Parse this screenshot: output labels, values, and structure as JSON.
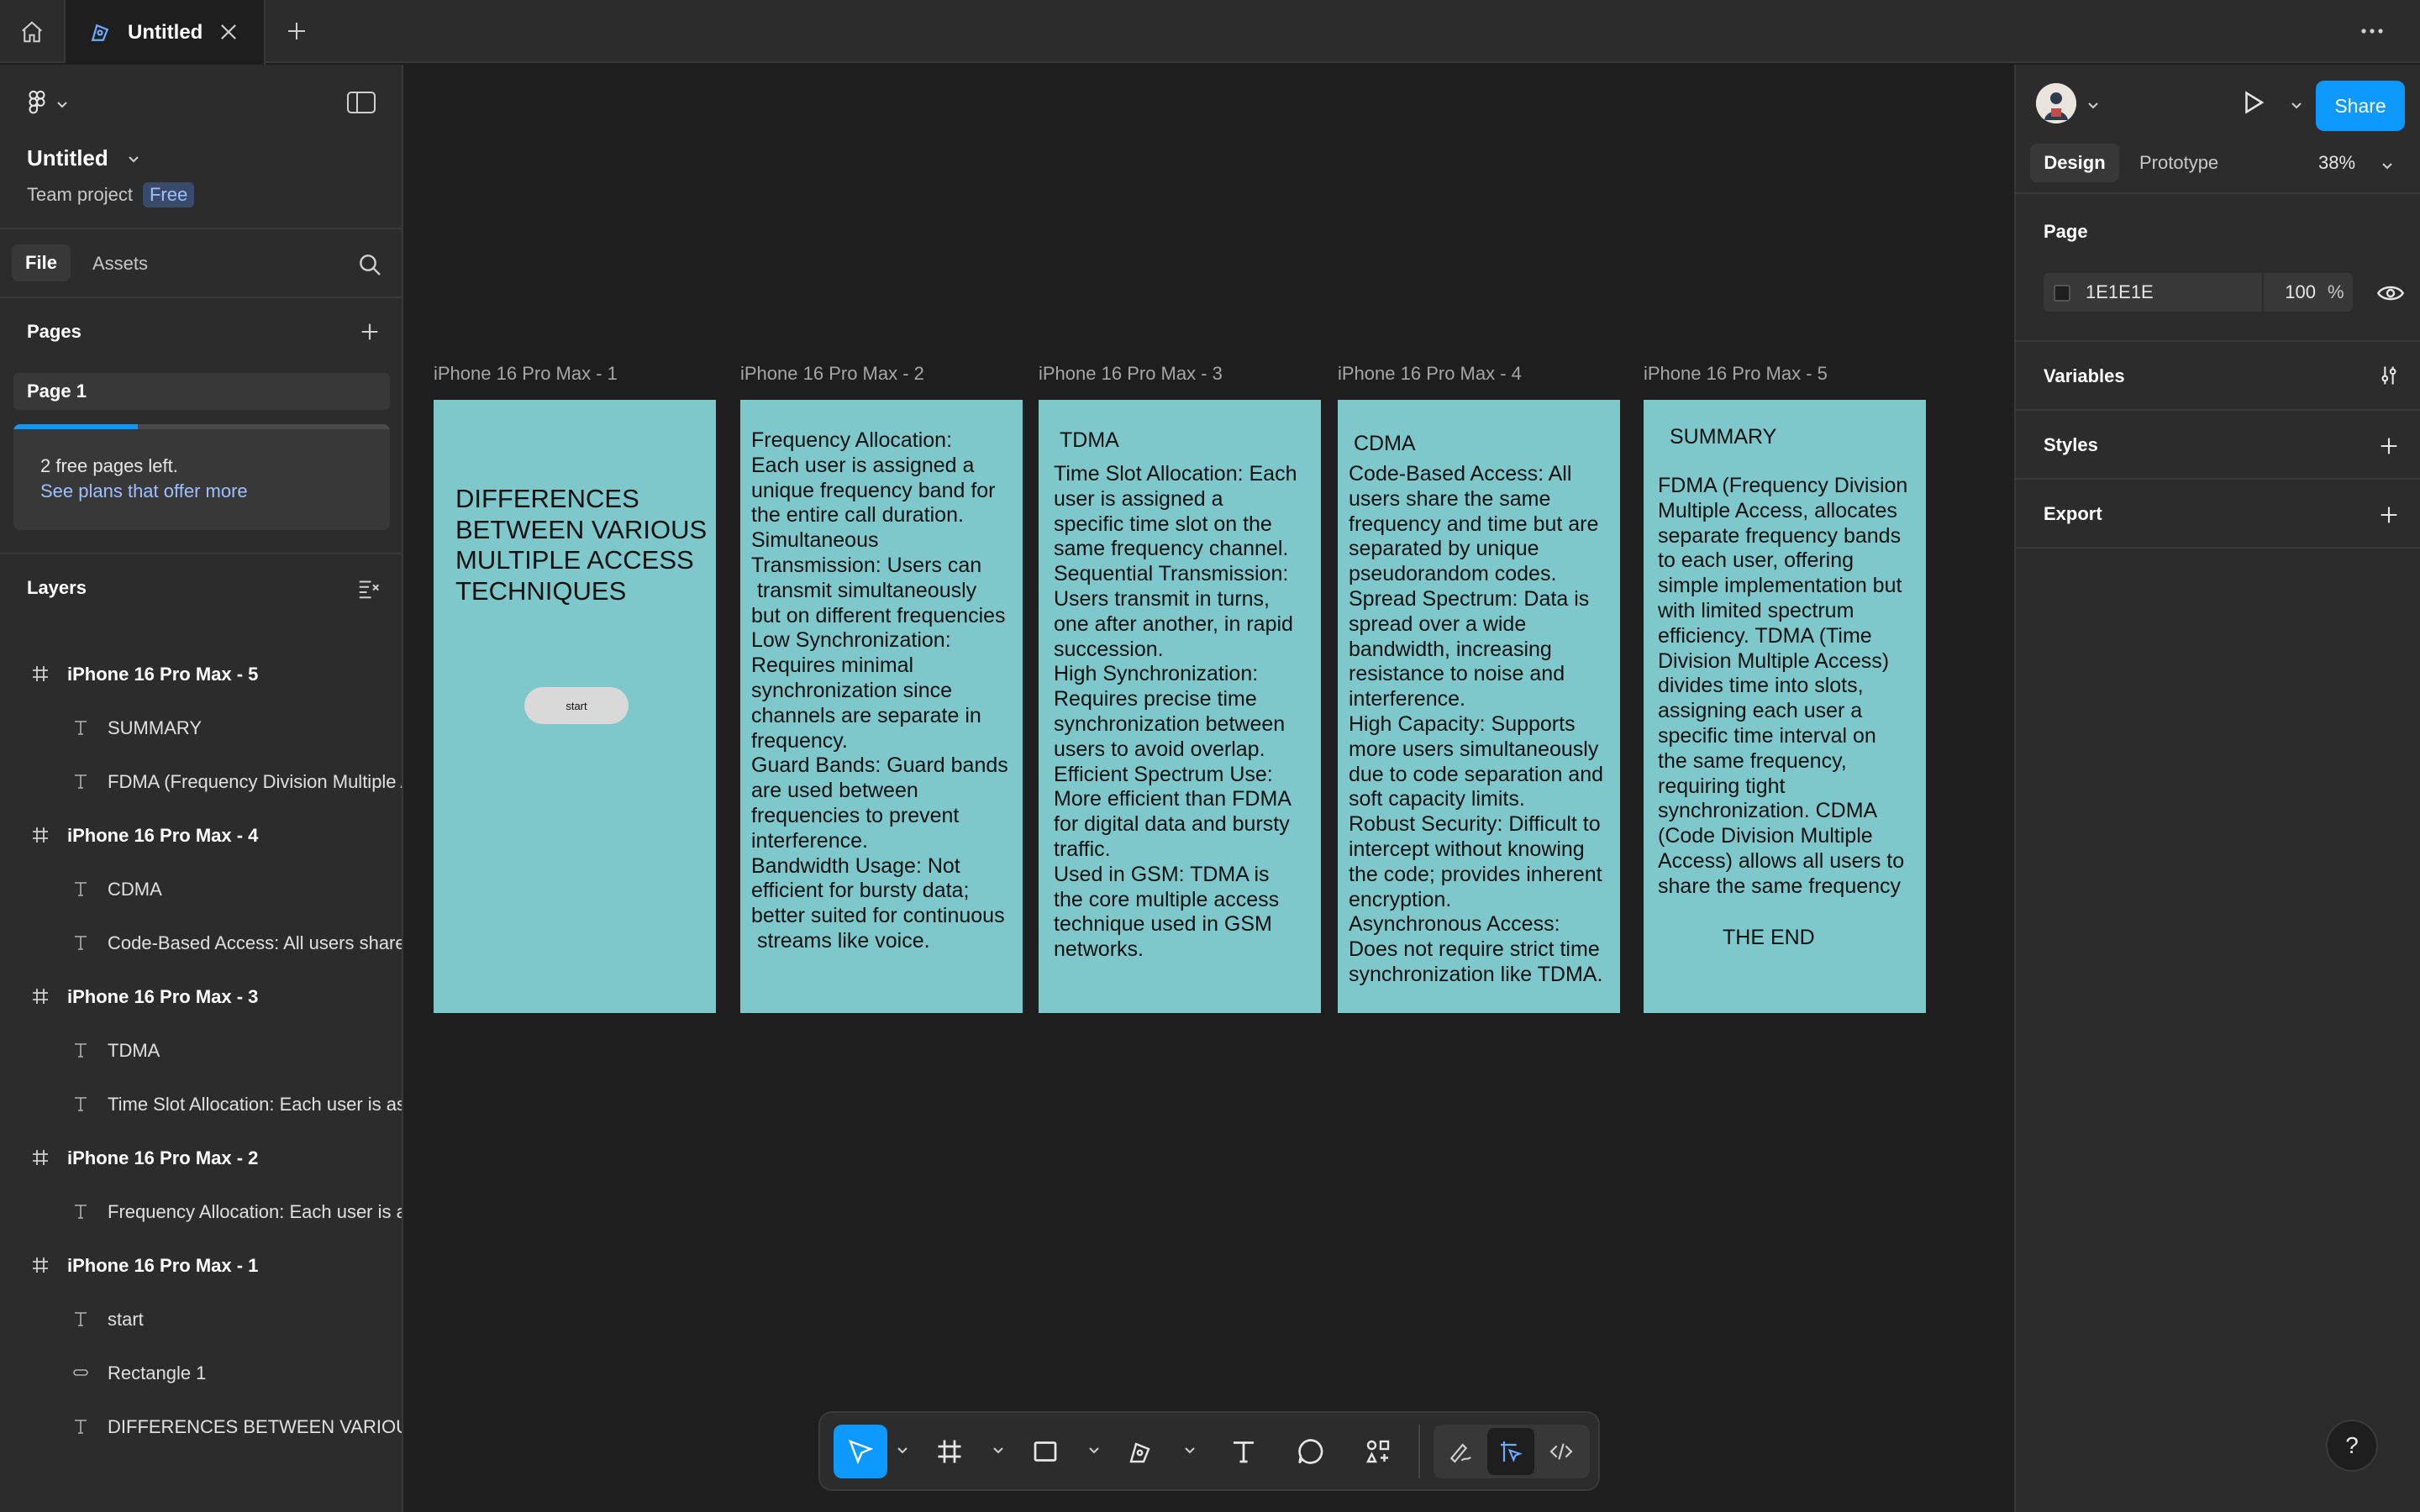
{
  "tabs": {
    "active_title": "Untitled"
  },
  "left_panel": {
    "file_name": "Untitled",
    "team_label": "Team project",
    "plan_badge": "Free",
    "tab_file": "File",
    "tab_assets": "Assets",
    "pages_header": "Pages",
    "pages": [
      {
        "label": "Page 1"
      }
    ],
    "pages_used_fraction": 0.33,
    "notice_text": "2 free pages left.",
    "notice_link": "See plans that offer more",
    "layers_header": "Layers",
    "layers": [
      {
        "label": "iPhone 16 Pro Max - 5",
        "kind": "frame"
      },
      {
        "label": "SUMMARY",
        "kind": "text"
      },
      {
        "label": "FDMA (Frequency Division Multiple Access, allocates",
        "kind": "text"
      },
      {
        "label": "iPhone 16 Pro Max - 4",
        "kind": "frame"
      },
      {
        "label": "CDMA",
        "kind": "text"
      },
      {
        "label": "Code-Based Access: All users share the same frequency",
        "kind": "text"
      },
      {
        "label": "iPhone 16 Pro Max - 3",
        "kind": "frame"
      },
      {
        "label": "TDMA",
        "kind": "text"
      },
      {
        "label": "Time Slot Allocation: Each user is assigned a specific",
        "kind": "text"
      },
      {
        "label": "iPhone 16 Pro Max - 2",
        "kind": "frame"
      },
      {
        "label": "Frequency Allocation: Each user is assigned a unique",
        "kind": "text"
      },
      {
        "label": "iPhone 16 Pro Max - 1",
        "kind": "frame"
      },
      {
        "label": "start",
        "kind": "text"
      },
      {
        "label": "Rectangle 1",
        "kind": "rectangle"
      },
      {
        "label": "DIFFERENCES BETWEEN VARIOUS MULTIPLE ACCESS TECHNIQUES",
        "kind": "text"
      }
    ]
  },
  "canvas": {
    "frames": [
      {
        "name": "iPhone 16 Pro Max - 1"
      },
      {
        "name": "iPhone 16 Pro Max - 2"
      },
      {
        "name": "iPhone 16 Pro Max - 3"
      },
      {
        "name": "iPhone 16 Pro Max - 4"
      },
      {
        "name": "iPhone 16 Pro Max - 5"
      }
    ],
    "frame1": {
      "title": "DIFFERENCES\nBETWEEN VARIOUS\nMULTIPLE ACCESS\nTECHNIQUES",
      "button_label": "start"
    },
    "frame2": {
      "body": "Frequency Allocation:\nEach user is assigned a\nunique frequency band for\nthe entire call duration.\nSimultaneous\nTransmission: Users can\n transmit simultaneously\nbut on different frequencies\nLow Synchronization:\nRequires minimal\nsynchronization since\nchannels are separate in\nfrequency.\nGuard Bands: Guard bands\nare used between\nfrequencies to prevent\ninterference.\nBandwidth Usage: Not\nefficient for bursty data;\nbetter suited for continuous\n streams like voice."
    },
    "frame3": {
      "heading": "TDMA",
      "body": "Time Slot Allocation: Each\nuser is assigned a\nspecific time slot on the\nsame frequency channel.\nSequential Transmission:\nUsers transmit in turns,\none after another, in rapid\nsuccession.\nHigh Synchronization:\nRequires precise time\nsynchronization between\nusers to avoid overlap.\nEfficient Spectrum Use:\nMore efficient than FDMA\nfor digital data and bursty\ntraffic.\nUsed in GSM: TDMA is\nthe core multiple access\ntechnique used in GSM\nnetworks."
    },
    "frame4": {
      "heading": "CDMA",
      "body": "Code-Based Access: All\nusers share the same\nfrequency and time but are\nseparated by unique\npseudorandom codes.\nSpread Spectrum: Data is\nspread over a wide\nbandwidth, increasing\nresistance to noise and\ninterference.\nHigh Capacity: Supports\nmore users simultaneously\ndue to code separation and\nsoft capacity limits.\nRobust Security: Difficult to\nintercept without knowing\nthe code; provides inherent\nencryption.\nAsynchronous Access:\nDoes not require strict time\nsynchronization like TDMA."
    },
    "frame5": {
      "heading": "SUMMARY",
      "body": "FDMA (Frequency Division\nMultiple Access, allocates\nseparate frequency bands\nto each user, offering\nsimple implementation but\nwith limited spectrum\nefficiency. TDMA (Time\nDivision Multiple Access)\ndivides time into slots,\nassigning each user a\nspecific time interval on\nthe same frequency,\nrequiring tight\nsynchronization. CDMA\n(Code Division Multiple\nAccess) allows all users to\nshare the same frequency",
      "ending": "THE END"
    },
    "frame_fill": "#7ec8cc"
  },
  "toolbar": {
    "tools": [
      "move-tool",
      "frame-tool",
      "shape-tool",
      "pen-tool",
      "text-tool",
      "comment-tool",
      "actions-tool"
    ],
    "modes": [
      "draw-mode",
      "design-mode",
      "dev-mode"
    ],
    "active_tool": "move-tool",
    "accent": "#0d99ff"
  },
  "right_panel": {
    "share_label": "Share",
    "tab_design": "Design",
    "tab_prototype": "Prototype",
    "zoom": "38%",
    "page_section": "Page",
    "page_color": "1E1E1E",
    "page_opacity": "100",
    "opacity_unit": "%",
    "variables_label": "Variables",
    "styles_label": "Styles",
    "export_label": "Export"
  },
  "help_label": "?"
}
